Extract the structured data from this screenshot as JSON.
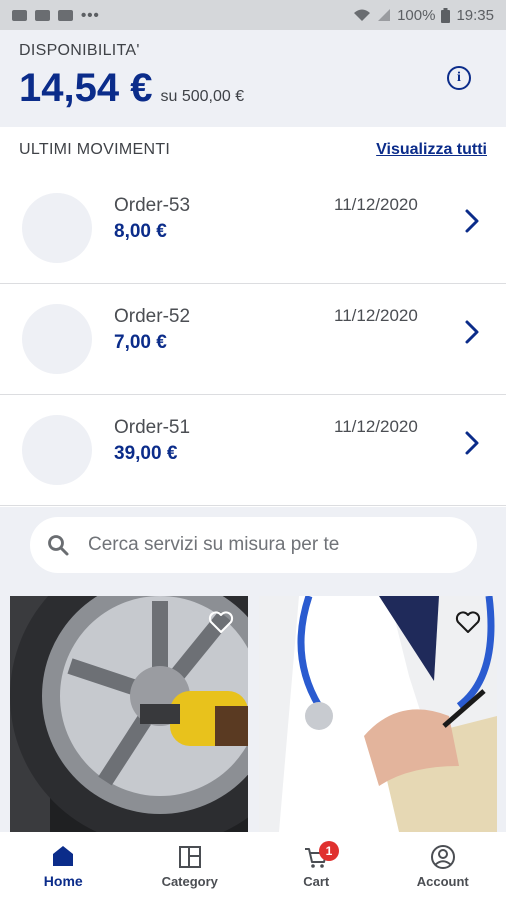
{
  "status_bar": {
    "battery": "100%",
    "time": "19:35"
  },
  "balance": {
    "label": "DISPONIBILITA'",
    "amount": "14,54 €",
    "limit": "su 500,00 €"
  },
  "movements": {
    "title": "ULTIMI MOVIMENTI",
    "view_all": "Visualizza tutti",
    "items": [
      {
        "name": "Order-53",
        "amount": "8,00 €",
        "date": "11/12/2020"
      },
      {
        "name": "Order-52",
        "amount": "7,00 €",
        "date": "11/12/2020"
      },
      {
        "name": "Order-51",
        "amount": "39,00 €",
        "date": "11/12/2020"
      }
    ]
  },
  "search": {
    "placeholder": "Cerca servizi su misura per te"
  },
  "cards": [
    {
      "icon": "heart-outline-icon"
    },
    {
      "icon": "heart-outline-icon"
    }
  ],
  "nav": {
    "items": [
      {
        "label": "Home",
        "icon": "home-icon"
      },
      {
        "label": "Category",
        "icon": "category-icon"
      },
      {
        "label": "Cart",
        "icon": "cart-icon",
        "badge": "1"
      },
      {
        "label": "Account",
        "icon": "account-icon"
      }
    ]
  },
  "colors": {
    "primary": "#0b2c8a",
    "badge": "#e0302e",
    "background": "#eef0f5"
  }
}
